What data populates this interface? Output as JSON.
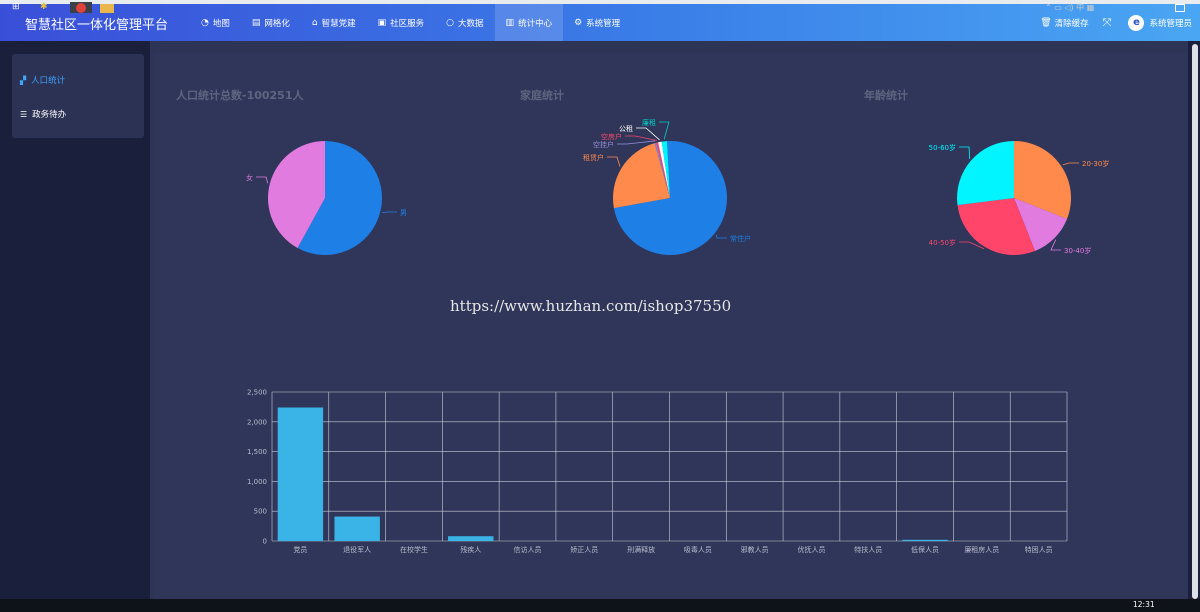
{
  "app": {
    "title": "智慧社区一体化管理平台"
  },
  "nav": [
    {
      "label": "地图",
      "icon": "dashboard-icon",
      "active": false
    },
    {
      "label": "网格化",
      "icon": "grid-list-icon",
      "active": false
    },
    {
      "label": "智慧党建",
      "icon": "institution-icon",
      "active": false
    },
    {
      "label": "社区服务",
      "icon": "id-card-icon",
      "active": false
    },
    {
      "label": "大数据",
      "icon": "circle-icon",
      "active": false
    },
    {
      "label": "统计中心",
      "icon": "bar-chart-icon",
      "active": true
    },
    {
      "label": "系统管理",
      "icon": "gears-icon",
      "active": false
    }
  ],
  "tools": {
    "clear_cache": "清除缓存",
    "user": "系统管理员"
  },
  "sidebar": {
    "items": [
      {
        "label": "人口统计",
        "icon": "cubes-icon",
        "active": true
      },
      {
        "label": "政务待办",
        "icon": "html5-icon",
        "active": false
      }
    ]
  },
  "watermark": "https://www.huzhan.com/ishop37550",
  "taskbar": {
    "time": "12:31"
  },
  "colors": {
    "accent": "#3a7ee8",
    "active_sidebar": "#3fa3ff",
    "bar": "#3ab4e6",
    "pie_blue": "#1e7fe6",
    "pie_violet": "#e27be0",
    "pie_orange": "#ff8a4c",
    "pie_cyan": "#00f5ff",
    "pie_red": "#ff456a"
  },
  "chart_data": [
    {
      "type": "pie",
      "title": "人口统计总数-100251人",
      "categories": [
        "男",
        "女"
      ],
      "values": [
        58,
        42
      ],
      "colors": [
        "#1e7fe6",
        "#e27be0"
      ]
    },
    {
      "type": "pie",
      "title": "家庭统计",
      "categories": [
        "常住户",
        "租赁户",
        "空挂户",
        "空房户",
        "公租",
        "廉租"
      ],
      "values": [
        73,
        23.5,
        0.5,
        0.5,
        1,
        1.5
      ],
      "colors": [
        "#1e7fe6",
        "#ff8a4c",
        "#8a7fd4",
        "#ff456a",
        "#ffffff",
        "#00f5ff"
      ]
    },
    {
      "type": "pie",
      "title": "年龄统计",
      "categories": [
        "20-30岁",
        "30-40岁",
        "40-50岁",
        "50-60岁"
      ],
      "values": [
        31,
        13,
        29,
        27
      ],
      "colors": [
        "#ff8a4c",
        "#e27be0",
        "#ff456a",
        "#00f5ff"
      ]
    },
    {
      "type": "bar",
      "title": "",
      "categories": [
        "党员",
        "退役军人",
        "在校学生",
        "残疾人",
        "信访人员",
        "矫正人员",
        "刑满释放",
        "吸毒人员",
        "邪教人员",
        "优抚人员",
        "特扶人员",
        "低保人员",
        "廉租房人员",
        "特困人员"
      ],
      "values": [
        2240,
        410,
        0,
        80,
        0,
        0,
        0,
        0,
        0,
        0,
        0,
        20,
        0,
        0
      ],
      "ylim": [
        0,
        2500
      ],
      "yticks": [
        "0",
        "500",
        "1,000",
        "1,500",
        "2,000",
        "2,500"
      ],
      "grid": true
    }
  ]
}
